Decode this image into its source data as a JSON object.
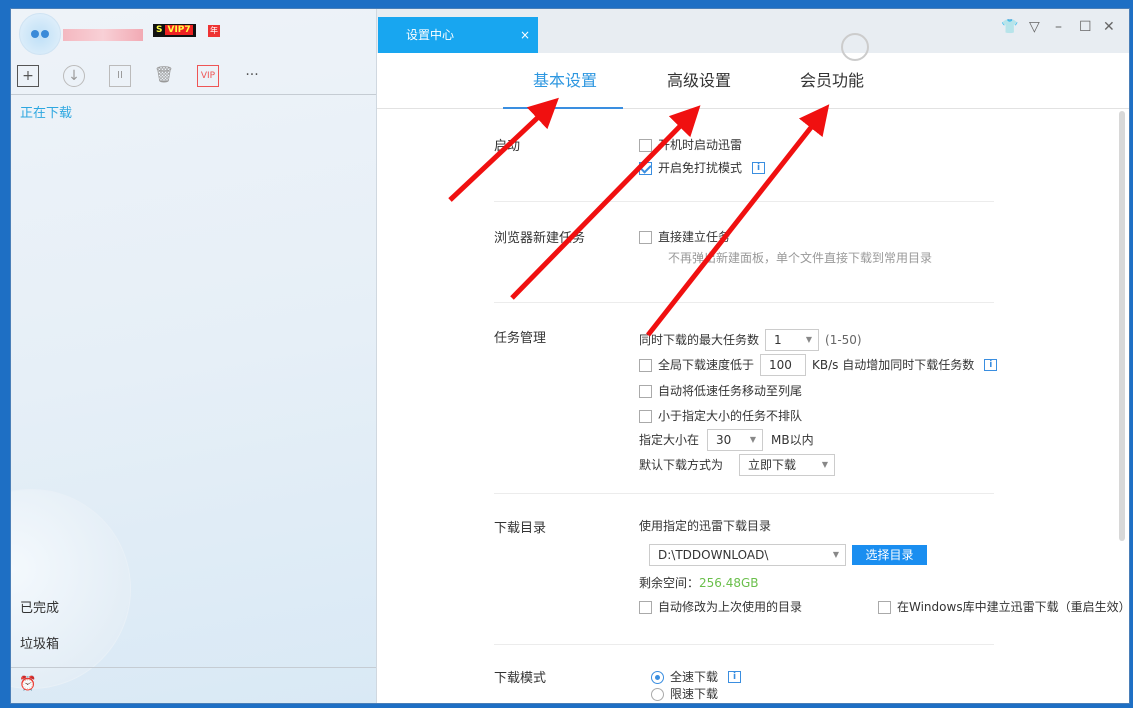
{
  "sidebar": {
    "vip_badge_s": "S",
    "vip_badge": "VIP7",
    "year_badge": "年",
    "toolbar": {
      "more": "···",
      "vip": "VIP"
    },
    "items": [
      {
        "label": "正在下载"
      },
      {
        "label": "已完成"
      },
      {
        "label": "垃圾箱"
      }
    ]
  },
  "header": {
    "tab_title": "设置中心",
    "tab_close": "×"
  },
  "settings": {
    "tabs": [
      {
        "label": "基本设置"
      },
      {
        "label": "高级设置"
      },
      {
        "label": "会员功能"
      }
    ],
    "startup": {
      "label": "启动",
      "opt1": "开机时启动迅雷",
      "opt2": "开启免打扰模式"
    },
    "browser": {
      "label": "浏览器新建任务",
      "opt1": "直接建立任务",
      "hint": "不再弹出新建面板，单个文件直接下载到常用目录"
    },
    "task": {
      "label": "任务管理",
      "max_label": "同时下载的最大任务数",
      "max_value": "1",
      "max_range": "(1-50)",
      "speed_label": "全局下载速度低于",
      "speed_value": "100",
      "speed_suffix": "KB/s 自动增加同时下载任务数",
      "move_slow": "自动将低速任务移动至列尾",
      "small_noqueue": "小于指定大小的任务不排队",
      "size_label": "指定大小在",
      "size_value": "30",
      "size_suffix": "MB以内",
      "mode_label": "默认下载方式为",
      "mode_value": "立即下载"
    },
    "dir": {
      "label": "下载目录",
      "use_label": "使用指定的迅雷下载目录",
      "path": "D:\\TDDOWNLOAD\\",
      "choose": "选择目录",
      "free_label": "剩余空间：",
      "free_value": "256.48GB",
      "auto_last": "自动修改为上次使用的目录",
      "win_lib": "在Windows库中建立迅雷下载（重启生效）"
    },
    "mode": {
      "label": "下载模式",
      "full": "全速下载",
      "limit": "限速下载"
    }
  },
  "info_icon": "i"
}
